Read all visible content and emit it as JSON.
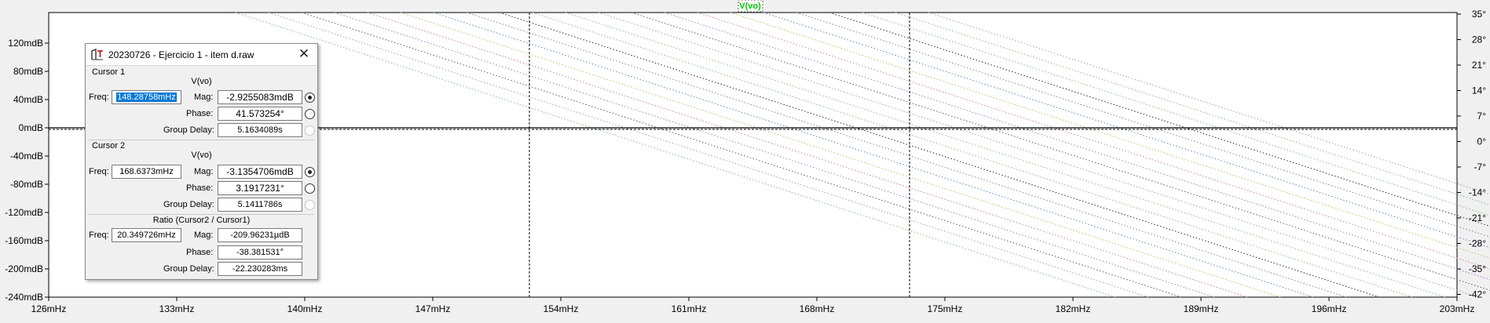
{
  "plot": {
    "trace_title": "V(vo)",
    "left_axis_ticks": [
      "120mdB",
      "80mdB",
      "40mdB",
      "0mdB",
      "-40mdB",
      "-80mdB",
      "-120mdB",
      "-160mdB",
      "-200mdB",
      "-240mdB"
    ],
    "right_axis_ticks": [
      "35°",
      "28°",
      "21°",
      "14°",
      "7°",
      "0°",
      "-7°",
      "-14°",
      "-21°",
      "-28°",
      "-35°",
      "-42°"
    ],
    "x_axis_ticks": [
      "126mHz",
      "133mHz",
      "140mHz",
      "147mHz",
      "154mHz",
      "161mHz",
      "168mHz",
      "175mHz",
      "182mHz",
      "189mHz",
      "196mHz",
      "203mHz"
    ],
    "colors": {
      "background": "#ffffff",
      "frame": "#000000",
      "trace_title": "#00cc00"
    }
  },
  "dialog": {
    "title": "20230726 - Ejercicio 1 - item d.raw",
    "close_glyph": "✕",
    "cursor1": {
      "group_label": "Cursor 1",
      "trace": "V(vo)",
      "freq_label": "Freq:",
      "freq": "148.28758mHz",
      "mag_label": "Mag:",
      "mag": "-2.9255083mdB",
      "phase_label": "Phase:",
      "phase": "41.573254°",
      "gd_label": "Group Delay:",
      "gd": "5.1634089s"
    },
    "cursor2": {
      "group_label": "Cursor 2",
      "trace": "V(vo)",
      "freq_label": "Freq:",
      "freq": "168.6373mHz",
      "mag_label": "Mag:",
      "mag": "-3.1354706mdB",
      "phase_label": "Phase:",
      "phase": "3.1917231°",
      "gd_label": "Group Delay:",
      "gd": "5.1411786s"
    },
    "ratio": {
      "group_label": "Ratio (Cursor2 / Cursor1)",
      "freq_label": "Freq:",
      "freq": "20.349726mHz",
      "mag_label": "Mag:",
      "mag": "-209.96231µdB",
      "phase_label": "Phase:",
      "phase": "-38.381531°",
      "gd_label": "Group Delay:",
      "gd": "-22.230283ms"
    }
  }
}
